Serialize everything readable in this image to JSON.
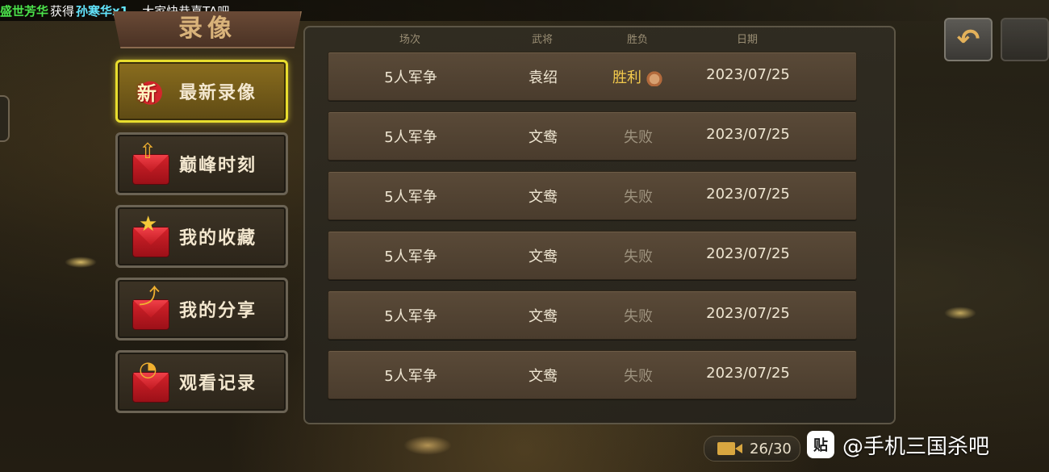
{
  "marquee": {
    "part1": "盛世芳华",
    "part2": "获得",
    "part3": "孙寒华x1",
    "part4": "，大家快恭喜TA吧"
  },
  "title": "录像",
  "menu": [
    {
      "label": "最新录像",
      "icon": "new-badge-icon",
      "badge": "新",
      "active": true
    },
    {
      "label": "巅峰时刻",
      "icon": "peak-arrow-envelope-icon",
      "active": false
    },
    {
      "label": "我的收藏",
      "icon": "star-envelope-icon",
      "active": false
    },
    {
      "label": "我的分享",
      "icon": "share-envelope-icon",
      "active": false
    },
    {
      "label": "观看记录",
      "icon": "clock-envelope-icon",
      "active": false
    }
  ],
  "table": {
    "headers": {
      "mode": "场次",
      "general": "武将",
      "result": "胜负",
      "date": "日期"
    },
    "rows": [
      {
        "mode": "5人军争",
        "general": "袁绍",
        "result": "胜利",
        "win": true,
        "date": "2023/07/25"
      },
      {
        "mode": "5人军争",
        "general": "文鸯",
        "result": "失败",
        "win": false,
        "date": "2023/07/25"
      },
      {
        "mode": "5人军争",
        "general": "文鸯",
        "result": "失败",
        "win": false,
        "date": "2023/07/25"
      },
      {
        "mode": "5人军争",
        "general": "文鸯",
        "result": "失败",
        "win": false,
        "date": "2023/07/25"
      },
      {
        "mode": "5人军争",
        "general": "文鸯",
        "result": "失败",
        "win": false,
        "date": "2023/07/25"
      },
      {
        "mode": "5人军争",
        "general": "文鸯",
        "result": "失败",
        "win": false,
        "date": "2023/07/25"
      }
    ]
  },
  "counter": {
    "text": "26/30",
    "icon": "video-camera-icon"
  },
  "watermark": {
    "logo": "贴",
    "text": "@手机三国杀吧"
  },
  "colors": {
    "win": "#f2c94c",
    "lose": "#9d927e",
    "active_border": "#e8dd2e"
  }
}
